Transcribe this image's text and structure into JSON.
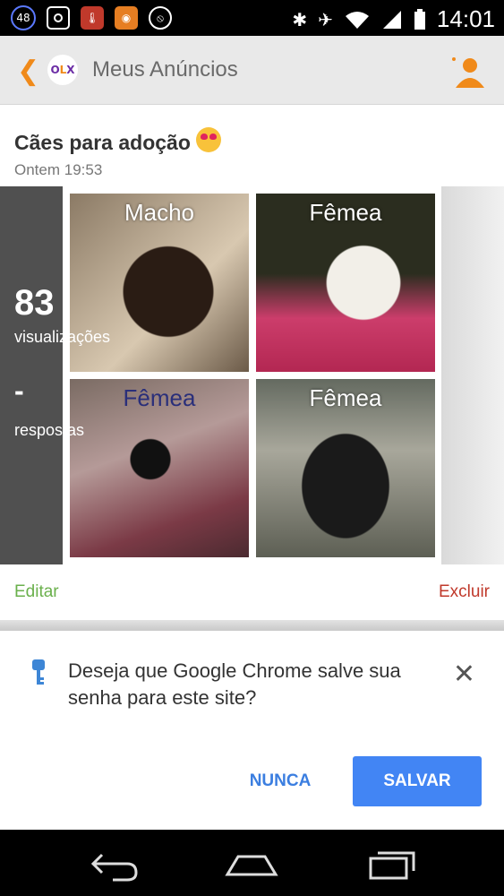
{
  "status_bar": {
    "badge": "48",
    "time": "14:01"
  },
  "app_bar": {
    "logo": "OLX",
    "title": "Meus Anúncios"
  },
  "ad": {
    "title": "Cães para adoção",
    "time": "Ontem 19:53",
    "views_count": "83",
    "views_label": "visualizações",
    "responses_count": "-",
    "responses_label": "respostas",
    "photo_labels": [
      "Macho",
      "Fêmea",
      "Fêmea",
      "Fêmea"
    ]
  },
  "actions": {
    "edit": "Editar",
    "delete": "Excluir"
  },
  "chrome_prompt": {
    "message": "Deseja que Google Chrome salve sua senha para este site?",
    "never": "NUNCA",
    "save": "SALVAR"
  },
  "colors": {
    "accent": "#f08a1a",
    "edit": "#6ab04c",
    "delete": "#c0392b",
    "save_button": "#4285f4"
  }
}
